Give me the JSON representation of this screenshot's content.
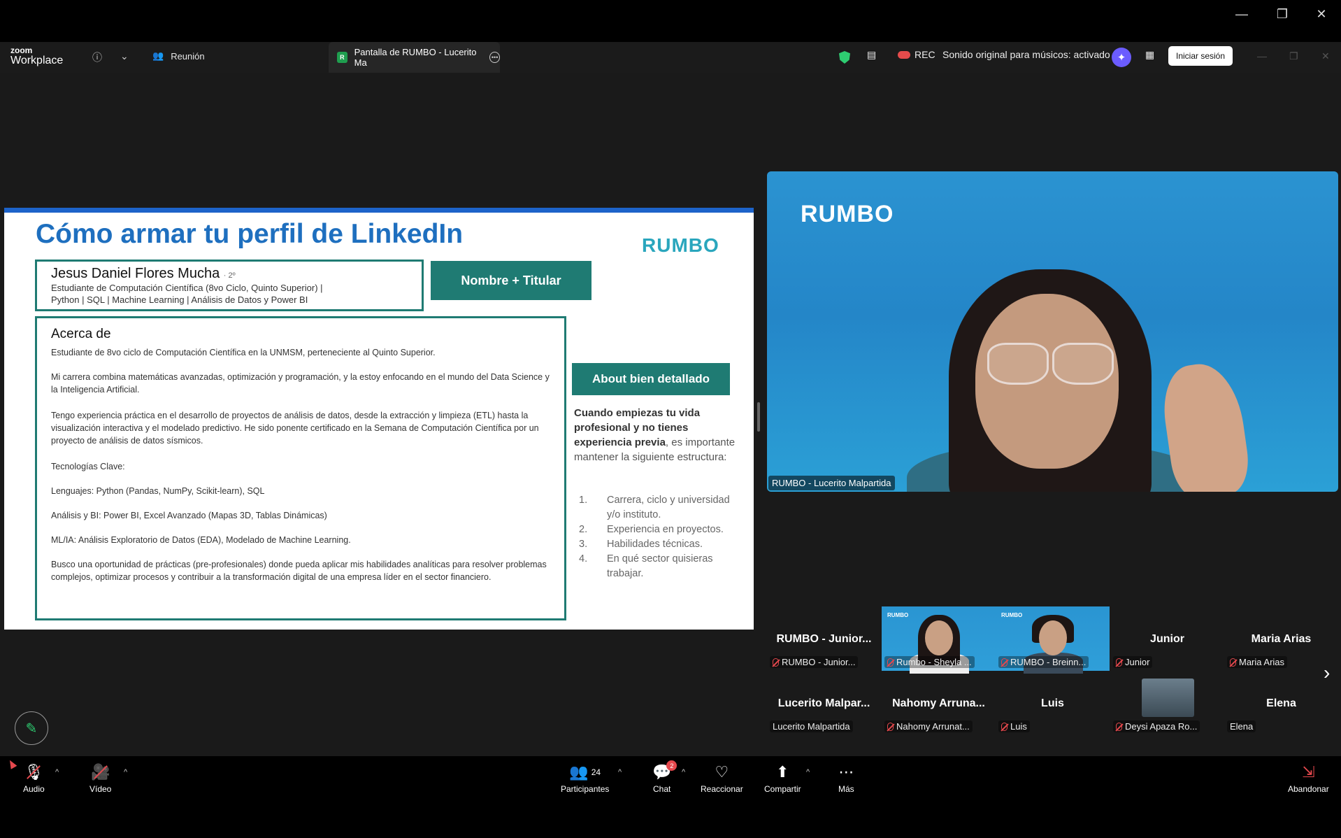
{
  "window": {
    "minimize": "—",
    "restore": "❐",
    "close": "✕"
  },
  "topbar": {
    "logo_top": "zoom",
    "logo_bottom": "Workplace",
    "meeting_tab": "Reunión",
    "share_tab_badge": "R",
    "share_tab": "Pantalla de RUMBO - Lucerito Ma",
    "rec": "REC",
    "original_sound": "Sonido original para músicos: activado",
    "signin": "Iniciar sesión"
  },
  "slide": {
    "title": "Cómo armar tu perfil de LinkedIn",
    "logo": "RUMBO",
    "profile_name": "Jesus Daniel Flores Mucha",
    "profile_degree": "· 2º",
    "headline_1": "Estudiante de Computación Científica (8vo Ciclo, Quinto Superior) |",
    "headline_2": "Python | SQL | Machine Learning | Análisis de Datos y Power BI",
    "tag_name": "Nombre + Titular",
    "about_heading": "Acerca de",
    "about_p1": "Estudiante de 8vo ciclo de Computación Científica en la UNMSM, perteneciente al Quinto Superior.",
    "about_p2": "Mi carrera combina matemáticas avanzadas, optimización y programación, y la estoy enfocando en el mundo del Data Science y la Inteligencia Artificial.",
    "about_p3": "Tengo experiencia práctica en el desarrollo de proyectos de análisis de datos, desde la extracción y limpieza (ETL) hasta la visualización interactiva y el modelado predictivo. He sido ponente certificado en la Semana de Computación Científica por un proyecto de análisis de datos sísmicos.",
    "about_p4": "Tecnologías Clave:",
    "about_p5": "Lenguajes: Python (Pandas, NumPy, Scikit-learn), SQL",
    "about_p6": "Análisis y BI: Power BI, Excel Avanzado (Mapas 3D, Tablas Dinámicas)",
    "about_p7": "ML/IA: Análisis Exploratorio de Datos (EDA), Modelado de Machine Learning.",
    "about_p8": "Busco una oportunidad de prácticas (pre-profesionales) donde pueda aplicar mis habilidades analíticas para resolver problemas complejos, optimizar procesos y contribuir a la transformación digital de una empresa líder en el sector financiero.",
    "tag_about": "About bien detallado",
    "side_bold": "Cuando empiezas tu vida profesional y no tienes experiencia previa",
    "side_rest": ", es importante mantener la siguiente estructura:",
    "list": [
      {
        "n": "1.",
        "text": "Carrera, ciclo y universidad y/o instituto."
      },
      {
        "n": "2.",
        "text": "Experiencia en proyectos."
      },
      {
        "n": "3.",
        "text": "Habilidades técnicas."
      },
      {
        "n": "4.",
        "text": "En qué sector quisieras trabajar."
      }
    ]
  },
  "speaker": {
    "logo": "RUMBO",
    "label": "RUMBO - Lucerito Malpartida"
  },
  "gallery": [
    {
      "name": "RUMBO - Junior...",
      "label": "RUMBO - Junior..."
    },
    {
      "name": "",
      "label": "Rumbo - Sheyla ...",
      "logo": "RUMBO"
    },
    {
      "name": "",
      "label": "RUMBO - Breinn...",
      "logo": "RUMBO"
    },
    {
      "name": "Junior",
      "label": "Junior"
    },
    {
      "name": "Maria Arias",
      "label": "Maria Arias"
    },
    {
      "name": "Lucerito Malpar...",
      "label": "Lucerito Malpartida"
    },
    {
      "name": "Nahomy Arruna...",
      "label": "Nahomy Arrunat..."
    },
    {
      "name": "Luis",
      "label": "Luis"
    },
    {
      "name": "",
      "label": "Deysi Apaza Ro..."
    },
    {
      "name": "Elena",
      "label": "Elena"
    }
  ],
  "toolbar": {
    "audio": "Audio",
    "video": "Vídeo",
    "participants": "Participantes",
    "participants_count": "24",
    "chat": "Chat",
    "chat_badge": "2",
    "react": "Reaccionar",
    "share": "Compartir",
    "more": "Más",
    "leave": "Abandonar"
  }
}
